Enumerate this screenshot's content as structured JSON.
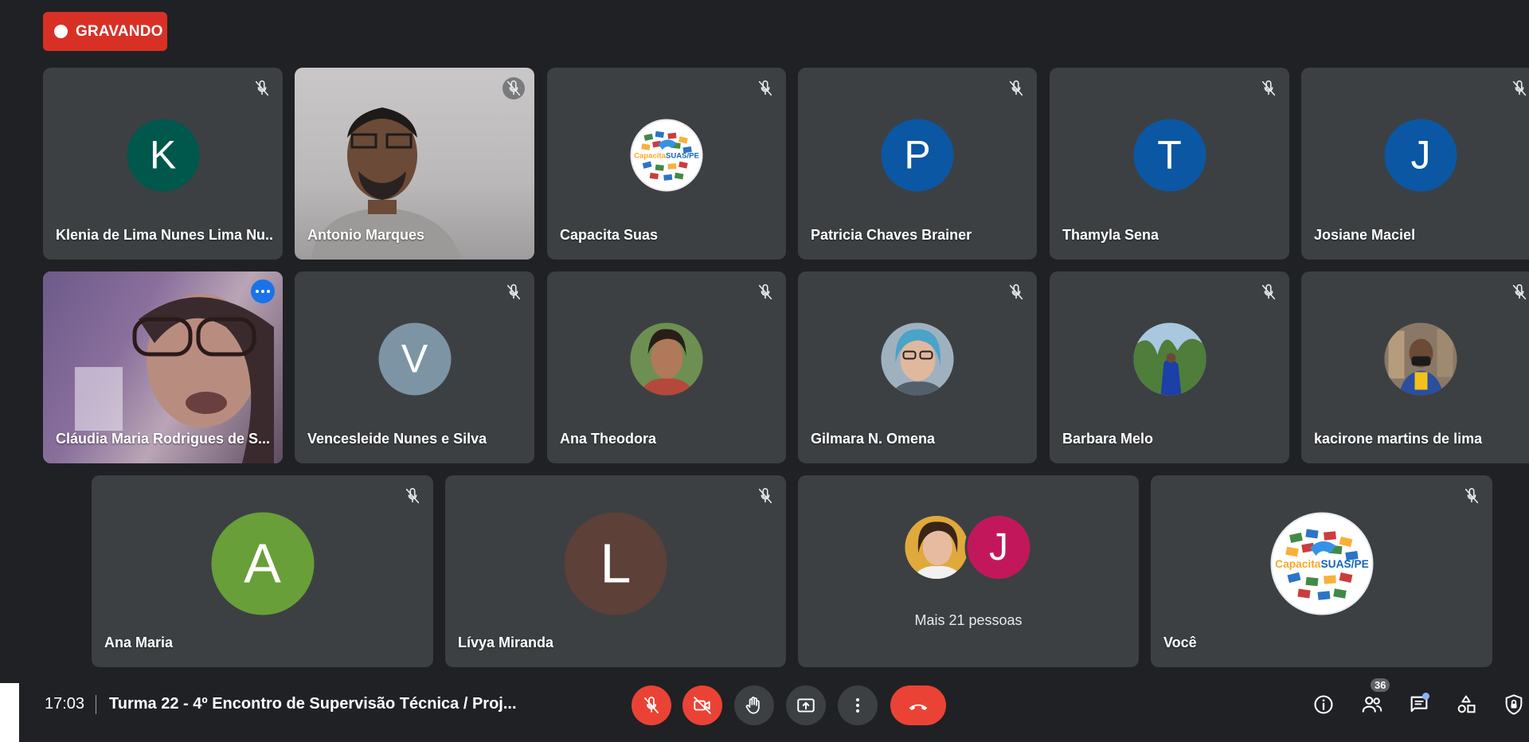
{
  "recording": {
    "label": "GRAVANDO",
    "color": "#d93025"
  },
  "tiles": [
    {
      "name": "Klenia de Lima Nunes Lima Nu...",
      "initial": "K",
      "avatar_color": "#00574b",
      "type": "initial"
    },
    {
      "name": "Antonio Marques",
      "type": "video"
    },
    {
      "name": "Capacita Suas",
      "type": "logo"
    },
    {
      "name": "Patricia Chaves Brainer",
      "initial": "P",
      "avatar_color": "#0b57a4",
      "type": "initial"
    },
    {
      "name": "Thamyla Sena",
      "initial": "T",
      "avatar_color": "#0b57a4",
      "type": "initial"
    },
    {
      "name": "Josiane Maciel",
      "initial": "J",
      "avatar_color": "#0b57a4",
      "type": "initial"
    },
    {
      "name": "Cláudia Maria Rodrigues de S...",
      "type": "video",
      "speaking": true
    },
    {
      "name": "Vencesleide Nunes e Silva",
      "initial": "V",
      "avatar_color": "#7d94a5",
      "type": "initial"
    },
    {
      "name": "Ana Theodora",
      "type": "photo"
    },
    {
      "name": "Gilmara N. Omena",
      "type": "photo"
    },
    {
      "name": "Barbara Melo",
      "type": "photo"
    },
    {
      "name": "kacirone martins de lima",
      "type": "photo"
    },
    {
      "name": "Ana Maria",
      "initial": "A",
      "avatar_color": "#689f38",
      "type": "initial"
    },
    {
      "name": "Lívya Miranda",
      "initial": "L",
      "avatar_color": "#5d4037",
      "type": "initial"
    },
    {
      "name": "",
      "type": "group",
      "more_label": "Mais 21 pessoas",
      "second_initial": "J"
    },
    {
      "name": "Você",
      "type": "logo"
    }
  ],
  "logo_text": {
    "part1": "Capacita",
    "part2": "SUAS/PE"
  },
  "bottom_bar": {
    "time": "17:03",
    "meeting_title": "Turma 22 - 4º Encontro de Supervisão Técnica / Proj...",
    "participants_count": "36"
  },
  "icons": {
    "mic_off": "mic-off-icon",
    "cam_off": "videocam-off-icon",
    "raise_hand": "hand-icon",
    "present": "present-screen-icon",
    "more": "more-vert-icon",
    "end_call": "call-end-icon",
    "info": "info-icon",
    "people": "people-icon",
    "chat": "chat-icon",
    "activities": "activities-icon",
    "host_controls": "host-controls-icon"
  },
  "colors": {
    "background": "#202124",
    "tile": "#3c4043",
    "danger": "#ea4335",
    "active_outline": "#8ab4f8"
  }
}
